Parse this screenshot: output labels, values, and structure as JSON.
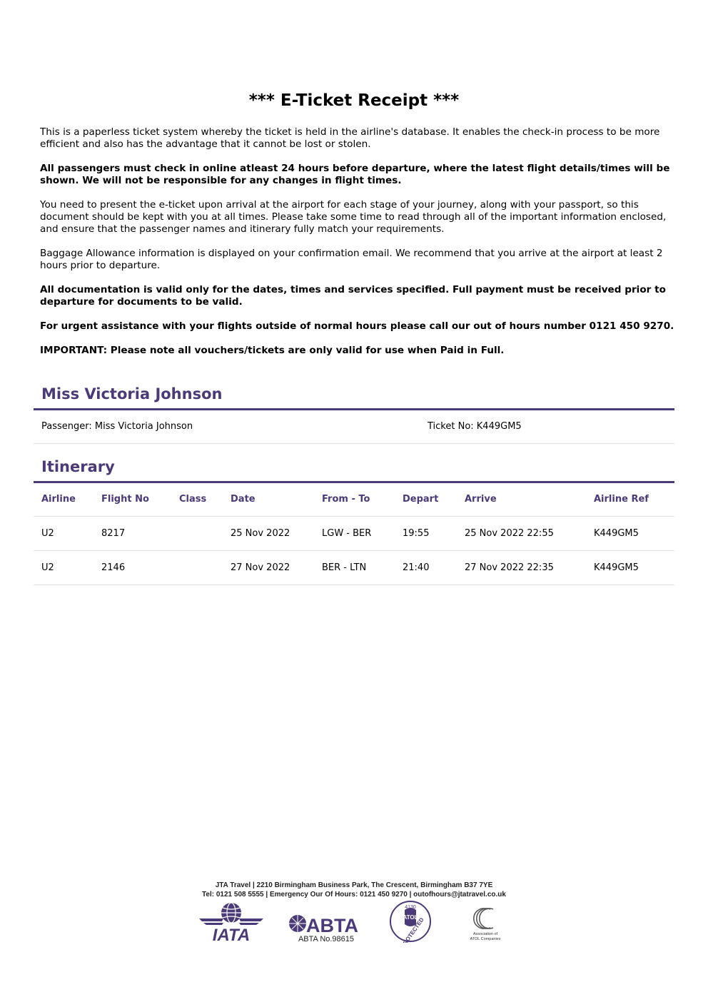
{
  "title": "*** E-Ticket Receipt ***",
  "intro": [
    {
      "text": "This is a paperless ticket system whereby the ticket is held in the airline's database. It enables the check-in process to be more efficient and also has the advantage that it cannot be lost or stolen.",
      "bold": false
    },
    {
      "text": "All passengers must check in online atleast 24 hours before departure, where the latest flight details/times will be shown. We will not be responsible for any changes in flight times.",
      "bold": true
    },
    {
      "text": "You need to present the e-ticket upon arrival at the airport for each stage of your journey, along with your passport, so this document should be kept with you at all times. Please take some time to read through all of the important information enclosed, and ensure that the passenger names and itinerary fully match your requirements.",
      "bold": false
    },
    {
      "text": "Baggage Allowance information is displayed on your confirmation email. We recommend that you arrive at the airport at least 2 hours prior to departure.",
      "bold": false
    },
    {
      "text": "All documentation is valid only for the dates, times and services specified. Full payment must be received prior to departure for documents to be valid.",
      "bold": true
    },
    {
      "text": "For urgent assistance with your flights outside of normal hours please call our out of hours number 0121 450 9270.",
      "bold": true
    },
    {
      "text": "IMPORTANT: Please note all vouchers/tickets are only valid for use when Paid in Full.",
      "bold": true
    }
  ],
  "passenger": {
    "heading": "Miss Victoria Johnson",
    "passenger_line": "Passenger: Miss Victoria Johnson",
    "ticket_line": "Ticket No: K449GM5"
  },
  "itinerary": {
    "heading": "Itinerary",
    "columns": [
      "Airline",
      "Flight No",
      "Class",
      "Date",
      "From - To",
      "Depart",
      "Arrive",
      "Airline Ref"
    ],
    "rows": [
      [
        "U2",
        "8217",
        "",
        "25 Nov 2022",
        "LGW - BER",
        "19:55",
        "25 Nov 2022 22:55",
        "K449GM5"
      ],
      [
        "U2",
        "2146",
        "",
        "27 Nov 2022",
        "BER - LTN",
        "21:40",
        "27 Nov 2022 22:35",
        "K449GM5"
      ]
    ]
  },
  "footer": {
    "line1": "JTA Travel | 2210 Birmingham Business Park, The Crescent, Birmingham B37 7YE",
    "line2": "Tel: 0121 508 5555 | Emergency Our Of Hours: 0121 450 9270 | outofhours@jtatravel.co.uk",
    "logos": {
      "iata": "IATA",
      "abta": "ABTA",
      "abta_no": "ABTA No.98615",
      "atol_number": "4130",
      "atol_text": "ATOL",
      "atol_protected": "PROTECTED",
      "assoc_line1": "Association of",
      "assoc_line2": "ATOL Companies"
    }
  },
  "colors": {
    "accent": "#4b3a78",
    "divider": "#e3e3e3"
  }
}
